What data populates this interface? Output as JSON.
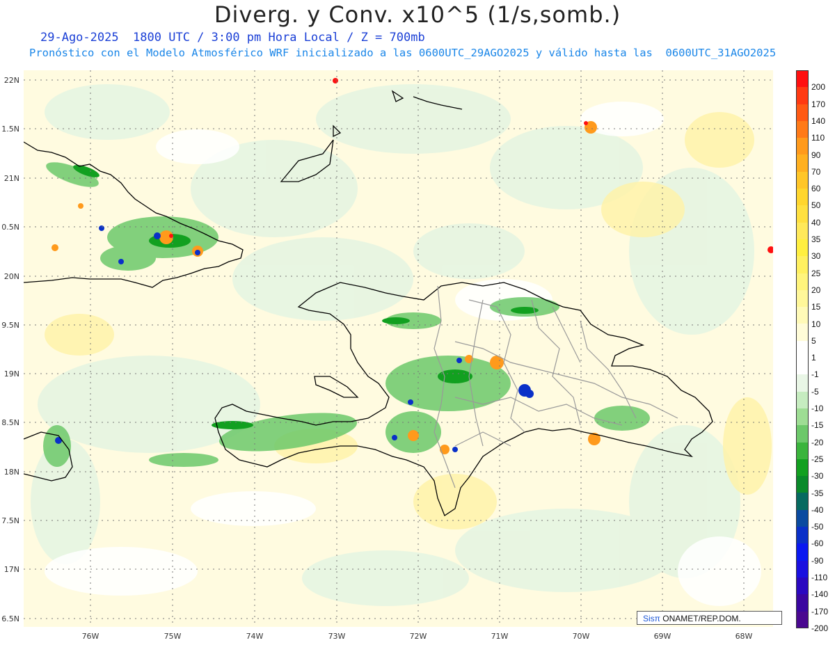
{
  "header": {
    "title": "Diverg. y Conv. x10^5 (1/s,somb.)",
    "line1": "29-Ago-2025  1800 UTC / 3:00 pm Hora Local / Z = 700mb",
    "line2": "Pronóstico con el Modelo Atmosférico WRF inicializado a las 0600UTC_29AGO2025 y válido hasta las  0600UTC_31AGO2025"
  },
  "map": {
    "lat_labels": [
      "22N",
      "1.5N",
      "21N",
      "0.5N",
      "20N",
      "9.5N",
      "19N",
      "8.5N",
      "18N",
      "7.5N",
      "17N",
      "6.5N"
    ],
    "lon_labels": [
      "76W",
      "75W",
      "74W",
      "73W",
      "72W",
      "71W",
      "70W",
      "69W",
      "68W"
    ]
  },
  "colorbar": {
    "labels": [
      "200",
      "170",
      "140",
      "110",
      "90",
      "70",
      "60",
      "50",
      "40",
      "35",
      "30",
      "25",
      "20",
      "15",
      "10",
      "5",
      "1",
      "-1",
      "-5",
      "-10",
      "-15",
      "-20",
      "-25",
      "-30",
      "-35",
      "-40",
      "-50",
      "-60",
      "-90",
      "-110",
      "-140",
      "-170",
      "-200"
    ],
    "colors": [
      "#ff1010",
      "#ff3a12",
      "#ff5a14",
      "#ff7a18",
      "#ff9a1c",
      "#ffb020",
      "#ffc628",
      "#ffd62e",
      "#ffe040",
      "#ffe95a",
      "#ffef40",
      "#fff060",
      "#fff47c",
      "#fff79a",
      "#fffab8",
      "#fffcd8",
      "#ffffff",
      "#ffffff",
      "#e9f6e6",
      "#c6ecc0",
      "#9edd94",
      "#6cc86a",
      "#3ab43c",
      "#12a020",
      "#0a8a2a",
      "#066a60",
      "#0a4aa0",
      "#0a30c8",
      "#0a18f0",
      "#1a10e0",
      "#2a08c0",
      "#3a06a0",
      "#4a0890"
    ]
  },
  "credit": {
    "brand": "Sisπ",
    "rest": " ONAMET/REP.DOM."
  }
}
